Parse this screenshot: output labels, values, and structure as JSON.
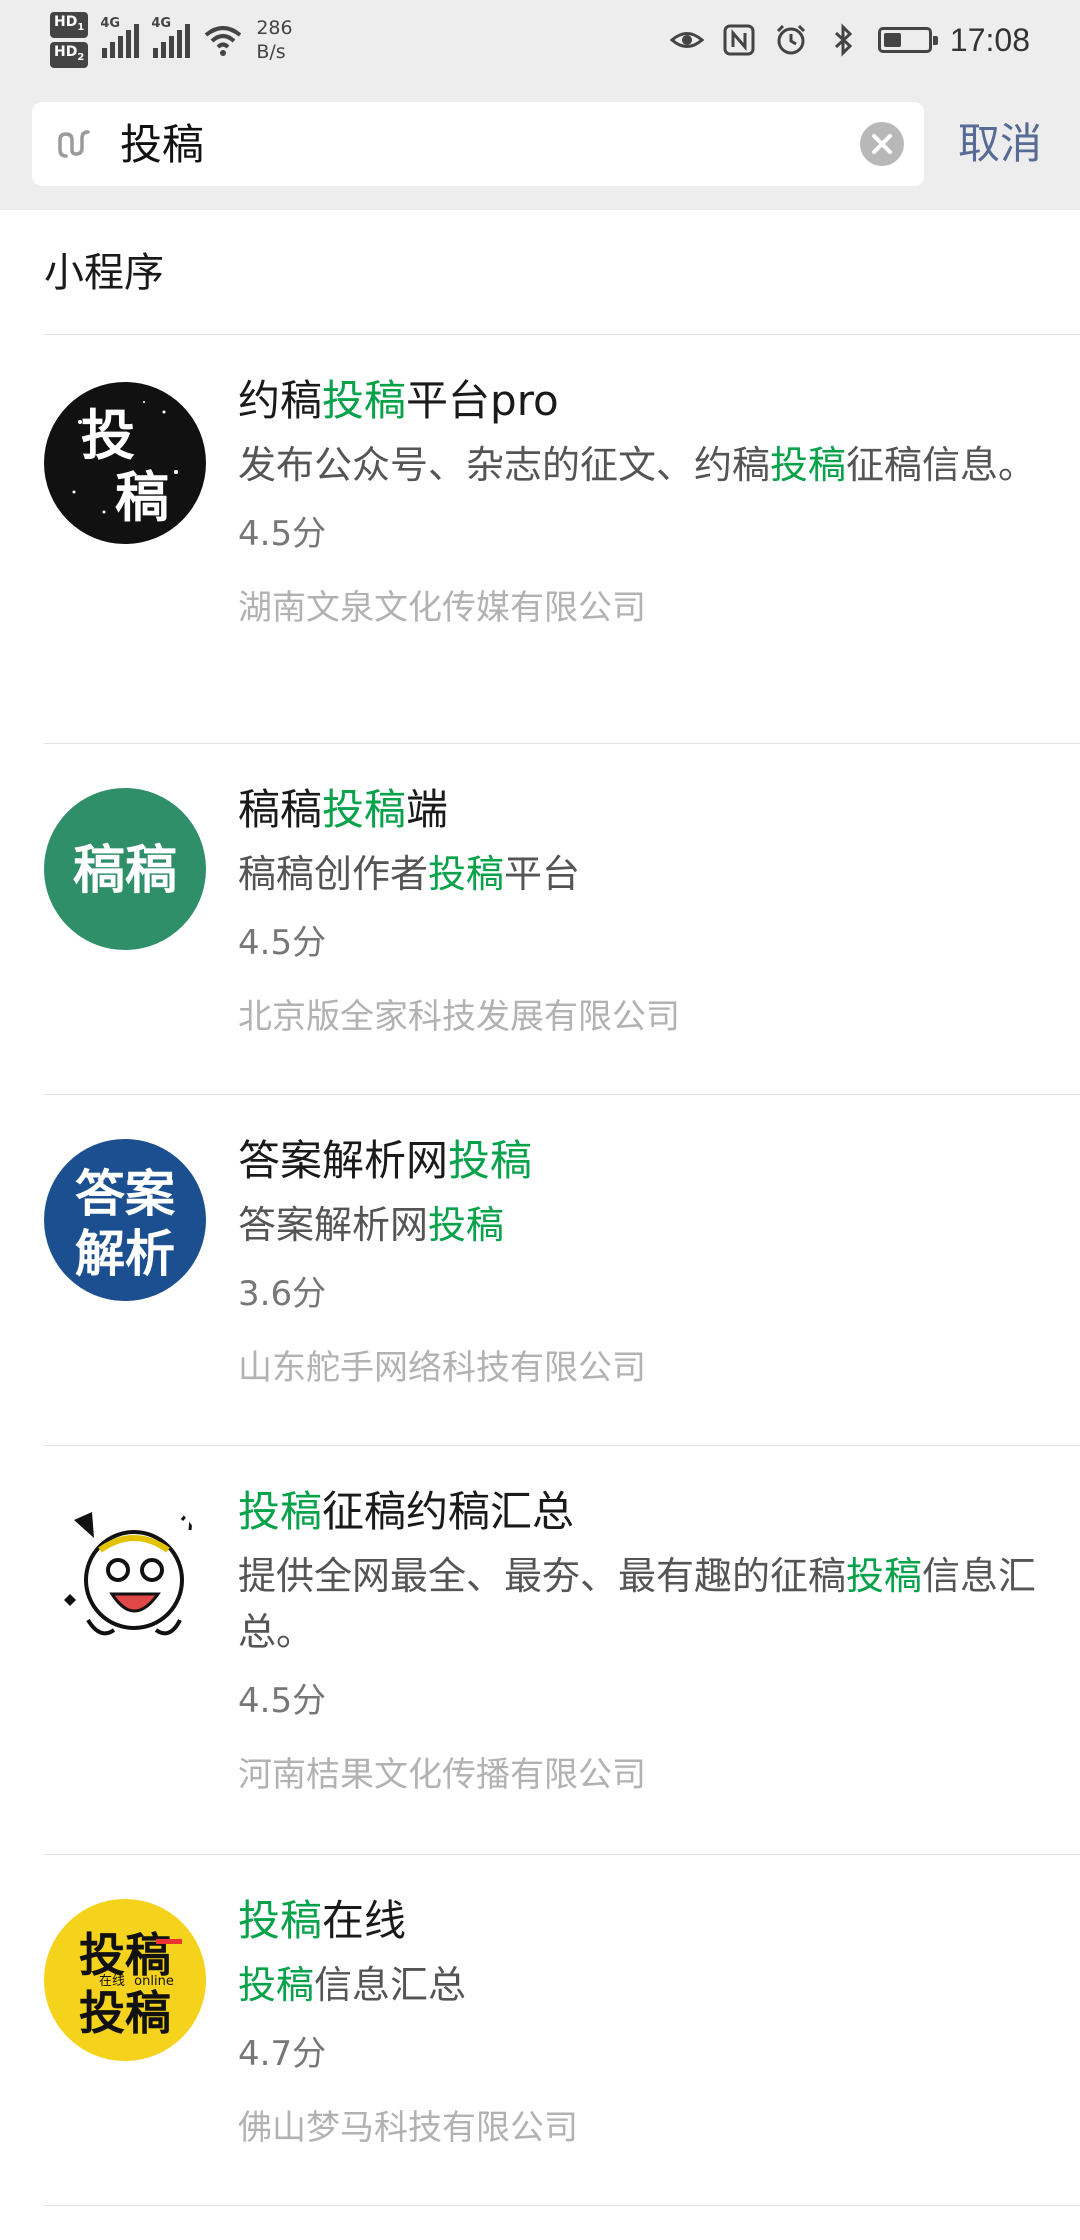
{
  "status_bar": {
    "hd1": "HD",
    "hd2": "HD",
    "signal1_tag": "4G",
    "signal2_tag": "4G",
    "speed_value": "286",
    "speed_unit": "B/s",
    "battery_level_percent": 40,
    "time": "17:08"
  },
  "search": {
    "query": "投稿",
    "cancel_label": "取消"
  },
  "section": {
    "title": "小程序"
  },
  "results": [
    {
      "title_parts": [
        "约稿",
        "投稿",
        "平台pro"
      ],
      "desc_parts": [
        "发布公众号、杂志的征文、约稿",
        "投稿",
        "征稿信息。"
      ],
      "score": "4.5分",
      "company": "湖南文泉文化传媒有限公司",
      "icon_text": [
        "投",
        "稿"
      ]
    },
    {
      "title_parts": [
        "稿稿",
        "投稿",
        "端"
      ],
      "desc_parts": [
        "稿稿创作者",
        "投稿",
        "平台"
      ],
      "score": "4.5分",
      "company": "北京版全家科技发展有限公司",
      "icon_text": [
        "稿稿"
      ]
    },
    {
      "title_parts": [
        "答案解析网",
        "投稿",
        ""
      ],
      "desc_parts": [
        "答案解析网",
        "投稿",
        ""
      ],
      "score": "3.6分",
      "company": "山东舵手网络科技有限公司",
      "icon_text": [
        "答案",
        "解析"
      ]
    },
    {
      "title_parts": [
        "",
        "投稿",
        "征稿约稿汇总"
      ],
      "desc_parts": [
        "提供全网最全、最夯、最有趣的征稿",
        "投稿",
        "信息汇总。"
      ],
      "score": "4.5分",
      "company": "河南桔果文化传播有限公司",
      "icon_text": []
    },
    {
      "title_parts": [
        "",
        "投稿",
        "在线"
      ],
      "desc_parts": [
        "",
        "投稿",
        "信息汇总"
      ],
      "score": "4.7分",
      "company": "佛山梦马科技有限公司",
      "icon_text": [
        "投稿",
        "投稿"
      ],
      "icon_small": [
        "在线",
        "online"
      ]
    }
  ]
}
